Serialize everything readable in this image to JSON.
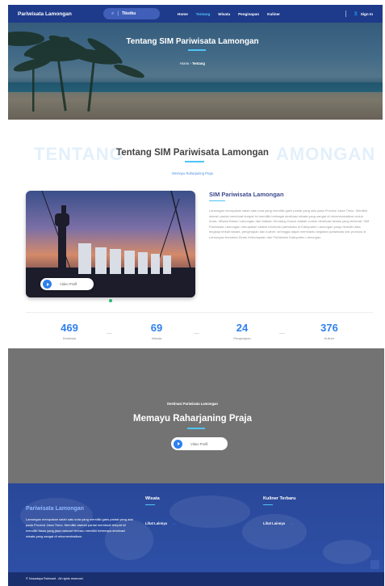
{
  "header": {
    "brand": "Pariwisata Lamongan",
    "search_label": "Tiketku",
    "nav": [
      {
        "label": "Home",
        "active": false
      },
      {
        "label": "Tentang",
        "active": true
      },
      {
        "label": "Wisata",
        "active": false
      },
      {
        "label": "Penginapan",
        "active": false
      },
      {
        "label": "Kuliner",
        "active": false
      }
    ],
    "signin_label": "Sign In"
  },
  "hero": {
    "title": "Tentang SIM Pariwisata Lamongan",
    "breadcrumb_home": "Home",
    "breadcrumb_current": "Tentang"
  },
  "about": {
    "ghost_left": "TENTANG",
    "ghost_right": "AMONGAN",
    "title": "Tentang SIM Pariwisata Lamongan",
    "subtitle": "Memayu Raharjaning Praja",
    "photo_button": "Video Profil",
    "info_title": "SIM Pariwisata Lamongan",
    "info_text": "Lamongan merupakan salah satu kota yang memiliki garis pantai yang ada pada Provinsi Jawa Timur. Memiliki daerah pantai membuat tempat ini memiliki berbagai destinasi wisata yang sangat di rekomendasikan untuk Anda. Wisata Bahari Lamongan dan Makam Sendang Duwur adalah contoh destinasi wisata yang terkenal. SIM Pariwisata Lamongan merupakan sistem informasi pariwisata di Kabupaten Lamongan yang memiliki data lengkap terkait wisata, penginapan dan kuliner, sehingga dapat membantu kegiatan pariwisata dan promosi di Lamongan bersama Dinas Kebudayaan dan Pariwisata Kabupaten Lamongan."
  },
  "stats": [
    {
      "value": "469",
      "label": "Destinasi"
    },
    {
      "value": "69",
      "label": "Wisata"
    },
    {
      "value": "24",
      "label": "Penginapan"
    },
    {
      "value": "376",
      "label": "Kuliner"
    }
  ],
  "band": {
    "kicker": "Destinasi Pariwisata Lamongan",
    "title": "Memayu Raharjaning Praja",
    "button": "Video Profil"
  },
  "footer": {
    "brand": "Pariwisata Lamongan",
    "description": "Lamongan merupakan salah satu kota yang memiliki garis pantai yang ada pada Provinsi Jawa Timur. Memiliki daerah pantai membuat tempat ini memiliki fasos yang jasa mencari terbaru memiliki beberapa destinasi wisata yang sangat di rekomendasikan.",
    "col_wisata_title": "Wisata",
    "col_wisata_link": "Lihat Lainnya",
    "col_kuliner_title": "Kuliner Terbaru",
    "col_kuliner_link": "Lihat Lainnya",
    "copyright": "© Nusadaya Rahmadi . All rights reserved."
  },
  "colors": {
    "primary": "#1e3a8a",
    "accent": "#4fc3f7",
    "stat_number": "#2f80ed",
    "band": "#737373",
    "footer": "#2d4fa5"
  }
}
